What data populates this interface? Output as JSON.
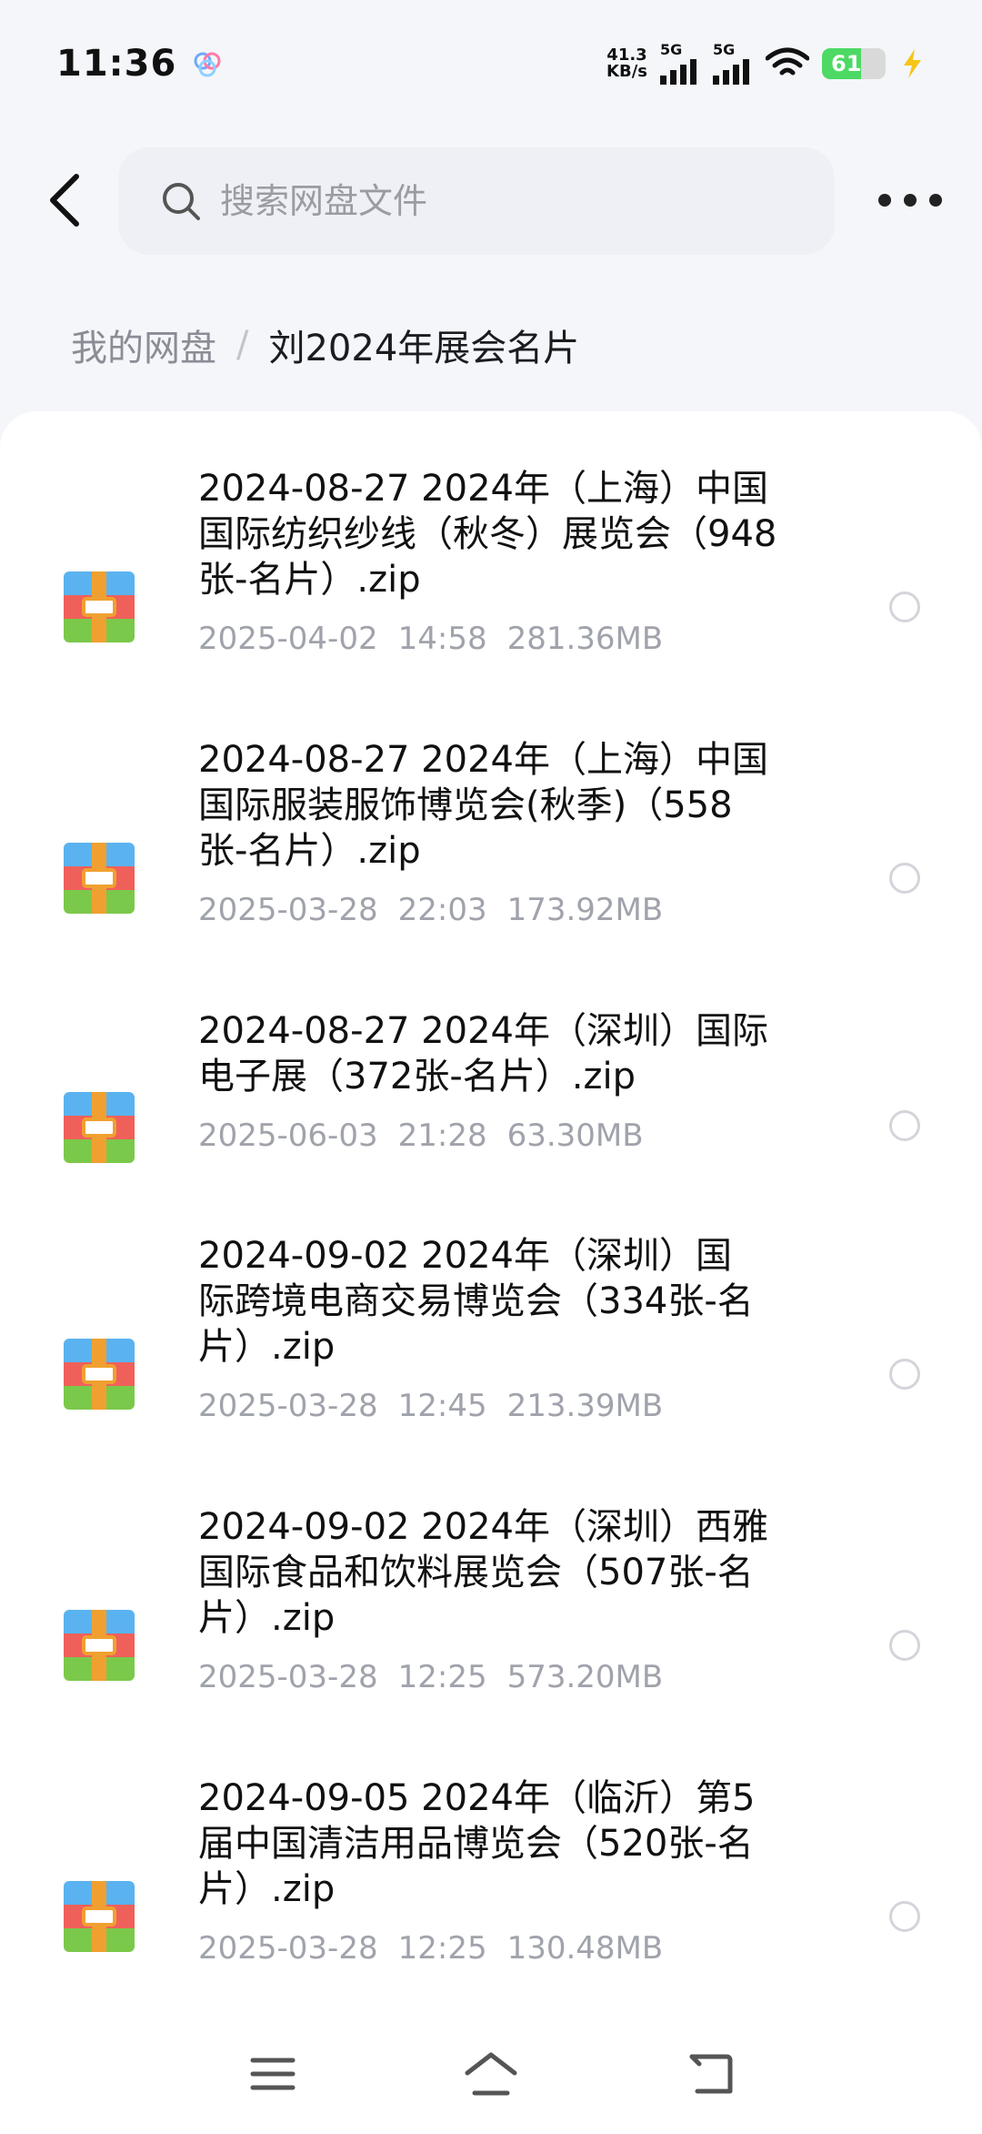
{
  "status_bar": {
    "time": "11:36",
    "net_speed_value": "41.3",
    "net_speed_unit": "KB/s",
    "signal1": "5G",
    "signal2": "5G",
    "battery": "61",
    "battery_level": 0.61
  },
  "search": {
    "placeholder": "搜索网盘文件"
  },
  "breadcrumb": {
    "root": "我的网盘",
    "separator": "/",
    "current": "刘2024年展会名片"
  },
  "files": [
    {
      "line1": "2024-08-27  2024年（上海）中国",
      "line2": "国际纺织纱线（秋冬）展览会（948",
      "line3": "张-名片）.zip",
      "date": "2025-04-02",
      "time": "14:58",
      "size": "281.36MB"
    },
    {
      "line1": "2024-08-27  2024年（上海）中国",
      "line2": "国际服装服饰博览会(秋季)（558",
      "line3": "张-名片）.zip",
      "date": "2025-03-28",
      "time": "22:03",
      "size": "173.92MB"
    },
    {
      "line1": "2024-08-27  2024年（深圳）国际",
      "line2": "电子展（372张-名片）.zip",
      "line3": "",
      "date": "2025-06-03",
      "time": "21:28",
      "size": "63.30MB"
    },
    {
      "line1": "2024-09-02  2024年（深圳）国",
      "line2": "际跨境电商交易博览会（334张-名",
      "line3": "片）.zip",
      "date": "2025-03-28",
      "time": "12:45",
      "size": "213.39MB"
    },
    {
      "line1": "2024-09-02  2024年（深圳）西雅",
      "line2": "国际食品和饮料展览会（507张-名",
      "line3": "片）.zip",
      "date": "2025-03-28",
      "time": "12:25",
      "size": "573.20MB"
    },
    {
      "line1": "2024-09-05  2024年（临沂）第5",
      "line2": "届中国清洁用品博览会（520张-名",
      "line3": "片）.zip",
      "date": "2025-03-28",
      "time": "12:25",
      "size": "130.48MB"
    }
  ],
  "colors": {
    "accent_green": "#4cd964",
    "zip_blue": "#5ab3f0",
    "zip_red": "#f0605a",
    "zip_green": "#7bc94a",
    "zip_orange": "#f0a030"
  }
}
